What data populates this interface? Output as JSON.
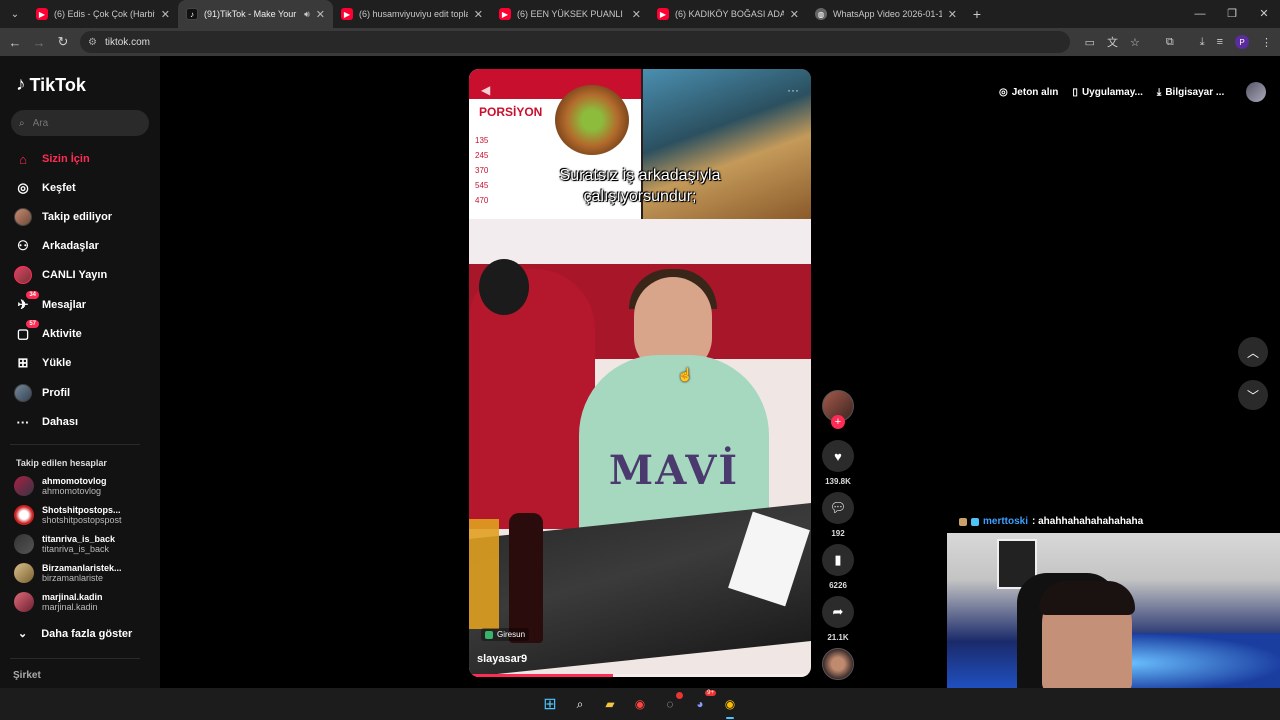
{
  "browser": {
    "tabs": [
      {
        "title": "(6) Edis - Çok Çok (Harbiye Kon…",
        "icon": "youtube-icon"
      },
      {
        "title": "(91)TikTok - Make Your Day",
        "icon": "tiktok-icon",
        "active": true
      },
      {
        "title": "(6) husamviyuviyu edit toplantı…",
        "icon": "youtube-icon"
      },
      {
        "title": "(6) EEN YÜKSEK PUANLI RESTO…",
        "icon": "youtube-icon"
      },
      {
        "title": "(6) KADIKÖY BOĞASI ADANA Y…",
        "icon": "youtube-icon"
      },
      {
        "title": "WhatsApp Video 2026-01-12 a…",
        "icon": "globe-icon"
      }
    ],
    "new_tab": "+",
    "url": "tiktok.com"
  },
  "sidebar": {
    "logo": "TikTok",
    "search_placeholder": "Ara",
    "nav": [
      {
        "label": "Sizin İçin",
        "icon": "home-icon"
      },
      {
        "label": "Keşfet",
        "icon": "compass-icon"
      },
      {
        "label": "Takip ediliyor",
        "icon": "following-icon"
      },
      {
        "label": "Arkadaşlar",
        "icon": "friends-icon"
      },
      {
        "label": "CANLI Yayın",
        "icon": "live-icon"
      },
      {
        "label": "Mesajlar",
        "icon": "message-icon",
        "badge": "34"
      },
      {
        "label": "Aktivite",
        "icon": "activity-icon",
        "badge": "57"
      },
      {
        "label": "Yükle",
        "icon": "upload-icon"
      },
      {
        "label": "Profil",
        "icon": "profile-icon"
      },
      {
        "label": "Dahası",
        "icon": "more-icon"
      }
    ],
    "following_title": "Takip edilen hesaplar",
    "following": [
      {
        "name": "ahmomotovlog",
        "handle": "ahmomotovlog"
      },
      {
        "name": "Shotshitpostops...",
        "handle": "shotshitpostopspost"
      },
      {
        "name": "titanriva_is_back",
        "handle": "titanriva_is_back"
      },
      {
        "name": "Birzamanlaristek...",
        "handle": "birzamanlariste"
      },
      {
        "name": "marjinal.kadin",
        "handle": "marjinal.kadin"
      }
    ],
    "show_more": "Daha fazla göster",
    "company": "Şirket"
  },
  "video": {
    "caption_line1": "Suratsız iş arkadaşıyla",
    "caption_line2": "çalışıyorsundur;",
    "menu_header": "PORSİYON",
    "menu_prices": [
      "135",
      "245",
      "370",
      "545",
      "470"
    ],
    "shirt_text": "MAVİ",
    "location": "Giresun",
    "author": "slayasar9",
    "progress": 0.42
  },
  "actions": {
    "likes": "139.8K",
    "comments": "192",
    "saves": "6226",
    "shares": "21.1K"
  },
  "topright": {
    "coins": "Jeton alın",
    "app": "Uygulamay...",
    "desktop": "Bilgisayar ..."
  },
  "chat": {
    "user": "merttoski",
    "message": ": ahahhahahahahahaha"
  },
  "accent": "#fe2c55"
}
